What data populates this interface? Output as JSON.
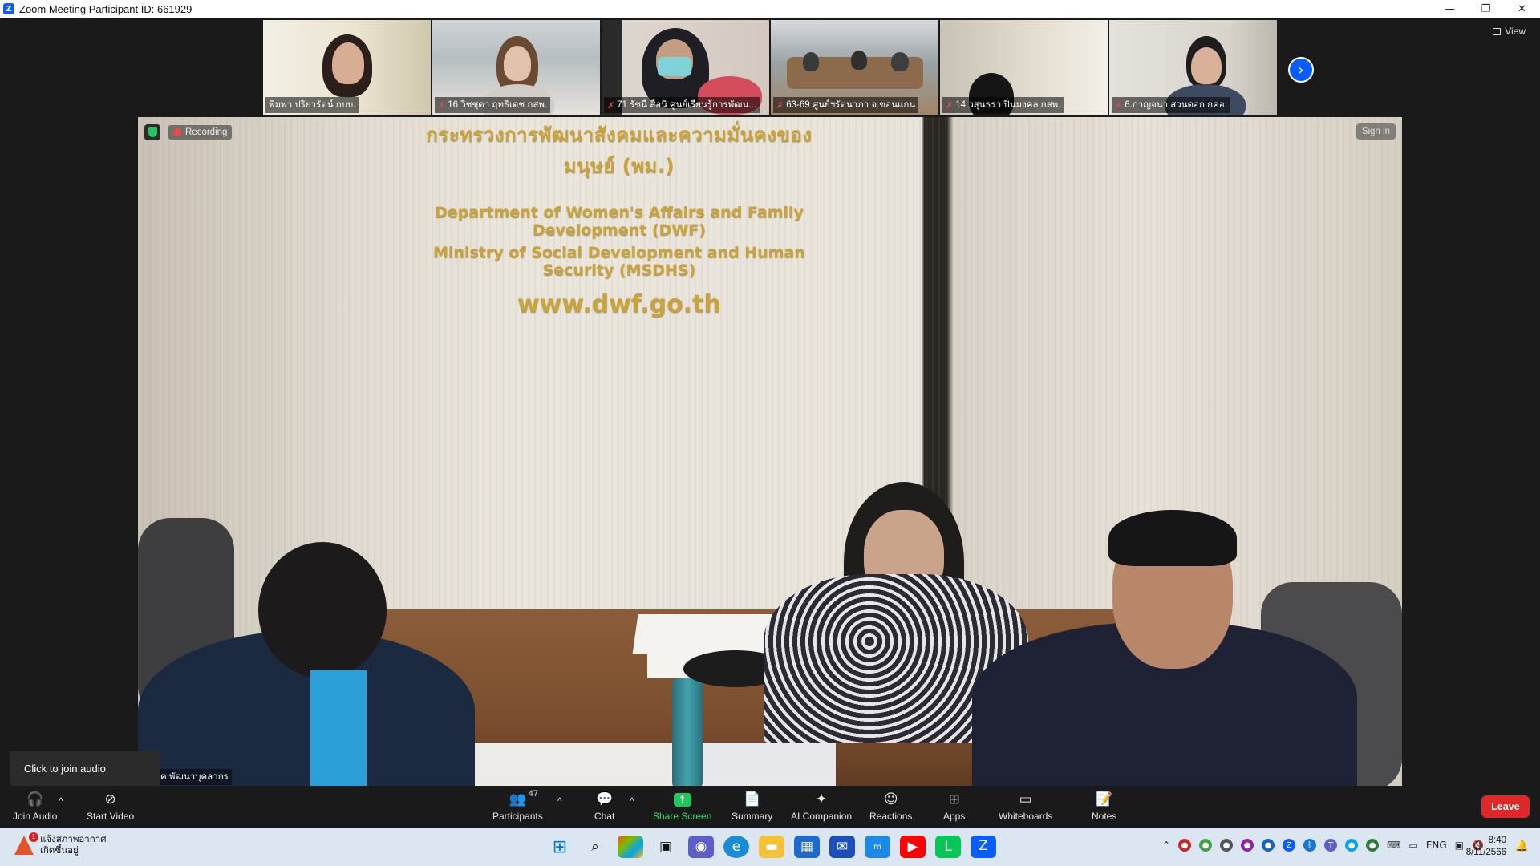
{
  "window": {
    "title": "Zoom Meeting Participant ID: 661929",
    "logo_letter": "Z",
    "minimize": "—",
    "maximize": "❐",
    "close": "✕"
  },
  "view_button": {
    "label": "View",
    "icon": "grid-icon"
  },
  "thumbnails": [
    {
      "name": "พิมพา ปริยารัตน์ กบบ.",
      "muted": false
    },
    {
      "name": "16 วิชชุดา ฤทธิเดช กสพ.",
      "muted": true
    },
    {
      "name": "71 รัชนี สือนิ ศูนย์เรียนรู้การพัฒน...",
      "muted": true
    },
    {
      "name": "63-69 ศูนย์ฯรัตนาภา จ.ขอนแกน",
      "muted": true
    },
    {
      "name": "14 วสุนธรา ปิ่นมงคล กสพ.",
      "muted": true
    },
    {
      "name": "6.กาญจนา สวนดอก กคอ.",
      "muted": true
    }
  ],
  "next_page_icon": "›",
  "main_video": {
    "recording_label": "Recording",
    "sign_in_label": "Sign in",
    "participant_name": "สค.พัฒนาบุคลากร",
    "sign_thai": "กระทรวงการพัฒนาสังคมและความมั่นคงของมนุษย์ (พม.)",
    "sign_en1": "Department of Women's Affairs and Family Development (DWF)",
    "sign_en2": "Ministry of Social Development and Human Security (MSDHS)",
    "sign_url": "www.dwf.go.th"
  },
  "tooltip": "Click to join audio",
  "toolbar": {
    "join_audio": "Join Audio",
    "start_video": "Start Video",
    "participants": "Participants",
    "participants_count": "47",
    "chat": "Chat",
    "share_screen": "Share Screen",
    "summary": "Summary",
    "ai_companion": "AI Companion",
    "reactions": "Reactions",
    "apps": "Apps",
    "whiteboards": "Whiteboards",
    "notes": "Notes",
    "leave": "Leave",
    "caret": "^"
  },
  "taskbar": {
    "weather_line1": "แจ้งสภาพอากาศ",
    "weather_line2": "เกิดขึ้นอยู่",
    "weather_badge": "1",
    "lang": "ENG",
    "time": "8:40",
    "date": "8/11/2566"
  }
}
